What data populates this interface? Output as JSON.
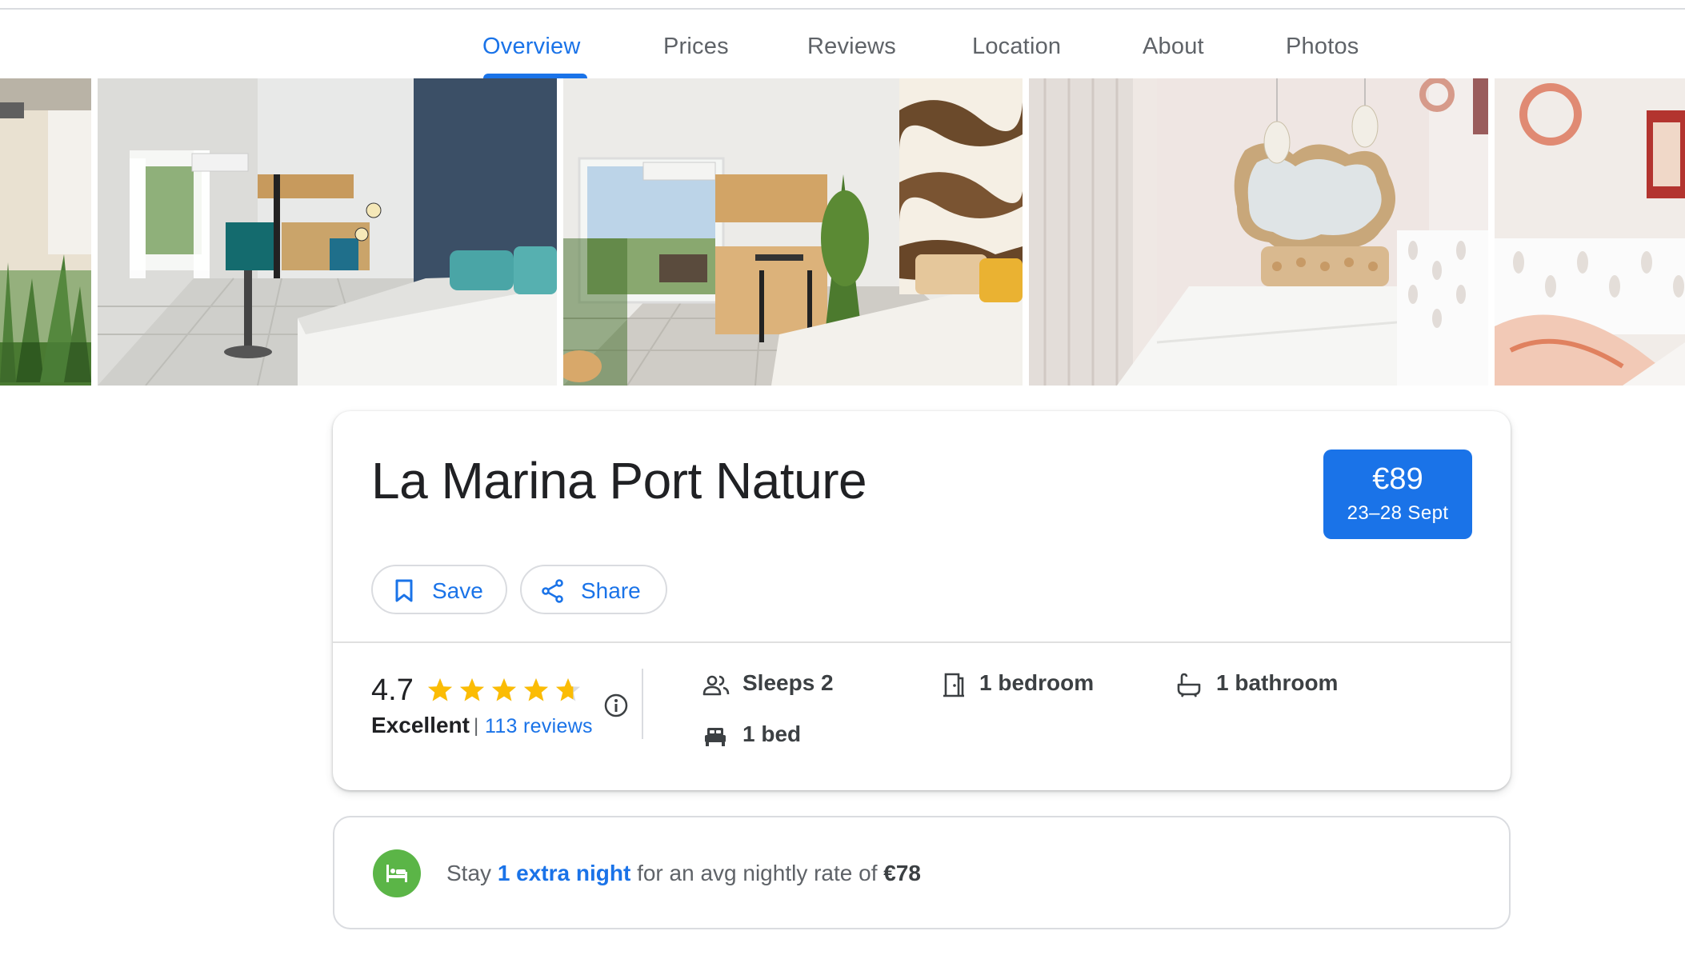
{
  "tabs": [
    {
      "label": "Overview",
      "active": true
    },
    {
      "label": "Prices"
    },
    {
      "label": "Reviews"
    },
    {
      "label": "Location"
    },
    {
      "label": "About"
    },
    {
      "label": "Photos"
    }
  ],
  "listing": {
    "title": "La Marina Port Nature",
    "price": "€89",
    "dates": "23–28 Sept",
    "save_label": "Save",
    "share_label": "Share"
  },
  "rating": {
    "score": "4.7",
    "stars_value": 4.7,
    "stars_max": 5,
    "label": "Excellent",
    "separator": "|",
    "reviews": "113 reviews"
  },
  "features": {
    "sleeps": "Sleeps 2",
    "bedrooms": "1 bedroom",
    "bathrooms": "1 bathroom",
    "beds": "1 bed"
  },
  "promo": {
    "prefix": "Stay ",
    "link": "1 extra night",
    "middle": " for an avg nightly rate of ",
    "rate": "€78"
  },
  "colors": {
    "accent": "#1a73e8",
    "star": "#fbbc04",
    "promo_icon_bg": "#5bb547"
  }
}
